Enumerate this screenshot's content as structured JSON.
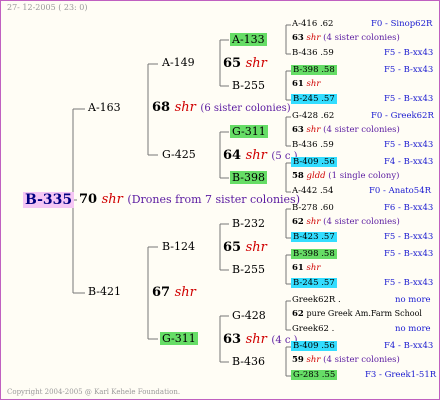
{
  "date": "27- 12-2005 ( 23: 0)",
  "copyright": "Copyright 2004-2005 @ Karl Kehele Foundation.",
  "root": "B-335",
  "l1": {
    "num": "70",
    "shr": "shr",
    "note": "(Drones from 7 sister colonies)"
  },
  "l2": {
    "top": "A-163",
    "bottom": "B-421"
  },
  "l3": {
    "a163": {
      "num": "68",
      "shr": "shr",
      "note": "(6 sister colonies)"
    },
    "b421": {
      "num": "67",
      "shr": "shr"
    }
  },
  "l4": {
    "a149": "A-149",
    "g425": "G-425",
    "b124": "B-124",
    "g311": "G-311"
  },
  "l5": {
    "a149": {
      "num": "65",
      "shr": "shr"
    },
    "g425": {
      "num": "64",
      "shr": "shr",
      "note": "(5 c.)"
    },
    "b124": {
      "num": "65",
      "shr": "shr"
    },
    "g311": {
      "num": "63",
      "shr": "shr",
      "note": "(4 c.)"
    }
  },
  "l6": {
    "a133": "A-133",
    "b255a": "B-255",
    "g311": "G-311",
    "b398": "B-398",
    "b232": "B-232",
    "b255b": "B-255",
    "g428": "G-428",
    "b436": "B-436"
  },
  "right": {
    "r1": {
      "name": "A-416",
      "val": ".62",
      "code": "F0 - Sinop62R"
    },
    "r2": {
      "num": "63",
      "shr": "shr",
      "note": "(4 sister colonies)"
    },
    "r3": {
      "name": "B-436",
      "val": ".59",
      "code": "F5 - B-xx43"
    },
    "r4": {
      "name": "B-398",
      "val": ".58",
      "code": "F5 - B-xx43"
    },
    "r5": {
      "num": "61",
      "shr": "shr"
    },
    "r6": {
      "name": "B-245",
      "val": ".57",
      "code": "F5 - B-xx43"
    },
    "r7": {
      "name": "G-428",
      "val": ".62",
      "code": "F0 - Greek62R"
    },
    "r8": {
      "num": "63",
      "shr": "shr",
      "note": "(4 sister colonies)"
    },
    "r9": {
      "name": "B-436",
      "val": ".59",
      "code": "F5 - B-xx43"
    },
    "r10": {
      "name": "B-409",
      "val": ".56",
      "code": "F4 - B-xx43"
    },
    "r11": {
      "num": "58",
      "shr": "gldd",
      "note": "(1 single colony)"
    },
    "r12": {
      "name": "A-442",
      "val": ".54",
      "code": "F0 - Anato54R"
    },
    "r13": {
      "name": "B-278",
      "val": ".60",
      "code": "F6 - B-xx43"
    },
    "r14": {
      "num": "62",
      "shr": "shr",
      "note": "(4 sister colonies)"
    },
    "r15": {
      "name": "B-423",
      "val": ".57",
      "code": "F5 - B-xx43"
    },
    "r16": {
      "name": "B-398",
      "val": ".58",
      "code": "F5 - B-xx43"
    },
    "r17": {
      "num": "61",
      "shr": "shr"
    },
    "r18": {
      "name": "B-245",
      "val": ".57",
      "code": "F5 - B-xx43"
    },
    "r19": {
      "name": "Greek62R",
      "val": ".",
      "code": "no more"
    },
    "r20": {
      "num": "62",
      "note": "pure Greek Am.Farm School"
    },
    "r21": {
      "name": "Greek62",
      "val": ".",
      "code": "no more"
    },
    "r22": {
      "name": "B-409",
      "val": ".56",
      "code": "F4 - B-xx43"
    },
    "r23": {
      "num": "59",
      "shr": "shr",
      "note": "(4 sister colonies)"
    },
    "r24": {
      "name": "G-283",
      "val": ".55",
      "code": "F3 - Greek1-51R"
    }
  },
  "colors": {
    "green": "#66dd66",
    "cyan": "#33ddff",
    "shr": "#d00000",
    "note": "#5a1aa0",
    "code": "#1a1ad0",
    "root_bg": "#f5c6f5",
    "border": "#c060c0"
  }
}
